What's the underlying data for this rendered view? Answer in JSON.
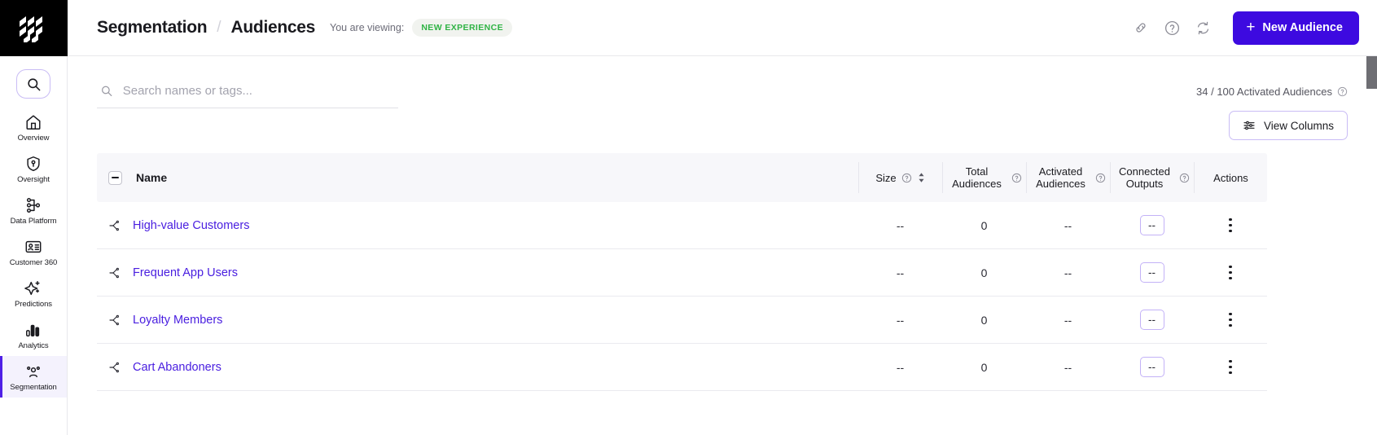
{
  "brand": {
    "logo_name": "app-logo",
    "accent_purple": "#3d0ae0",
    "link_purple": "#4a1fe0",
    "badge_green": "#2fb344"
  },
  "sidebar": {
    "search_icon": "search-icon",
    "items": [
      {
        "label": "Overview",
        "icon": "home-icon",
        "active": false
      },
      {
        "label": "Oversight",
        "icon": "shield-key-icon",
        "active": false
      },
      {
        "label": "Data Platform",
        "icon": "hierarchy-icon",
        "active": false
      },
      {
        "label": "Customer 360",
        "icon": "id-card-icon",
        "active": false
      },
      {
        "label": "Predictions",
        "icon": "sparkle-icon",
        "active": false
      },
      {
        "label": "Analytics",
        "icon": "bar-chart-icon",
        "active": false
      },
      {
        "label": "Segmentation",
        "icon": "people-icon",
        "active": true
      }
    ]
  },
  "header": {
    "breadcrumb_root": "Segmentation",
    "breadcrumb_separator": "/",
    "breadcrumb_current": "Audiences",
    "viewing_label": "You are viewing:",
    "experience_badge": "NEW EXPERIENCE",
    "icons": {
      "link": "link-icon",
      "help": "help-circle-icon",
      "refresh": "refresh-icon"
    },
    "new_audience_button": "New Audience",
    "new_audience_plus": "+"
  },
  "search": {
    "placeholder": "Search names or tags...",
    "value": "",
    "icon": "search-icon"
  },
  "toolbar": {
    "activated_count": "34 / 100 Activated Audiences",
    "activated_help_icon": "help-circle-icon",
    "view_columns_label": "View Columns",
    "view_columns_icon": "sliders-icon"
  },
  "table": {
    "select_all_state": "indeterminate",
    "columns": {
      "name": "Name",
      "size": "Size",
      "total_audiences": "Total Audiences",
      "activated_audiences": "Activated Audiences",
      "connected_outputs": "Connected Outputs",
      "actions": "Actions"
    },
    "sort_icon": "sort-arrows-icon",
    "help_icon": "help-circle-icon",
    "row_icon": "segment-branch-icon",
    "actions_icon": "kebab-menu-icon",
    "rows": [
      {
        "name": "High-value Customers",
        "size": "--",
        "total_audiences": "0",
        "activated_audiences": "--",
        "connected_outputs": "--"
      },
      {
        "name": "Frequent App Users",
        "size": "--",
        "total_audiences": "0",
        "activated_audiences": "--",
        "connected_outputs": "--"
      },
      {
        "name": "Loyalty Members",
        "size": "--",
        "total_audiences": "0",
        "activated_audiences": "--",
        "connected_outputs": "--"
      },
      {
        "name": "Cart Abandoners",
        "size": "--",
        "total_audiences": "0",
        "activated_audiences": "--",
        "connected_outputs": "--"
      }
    ]
  }
}
